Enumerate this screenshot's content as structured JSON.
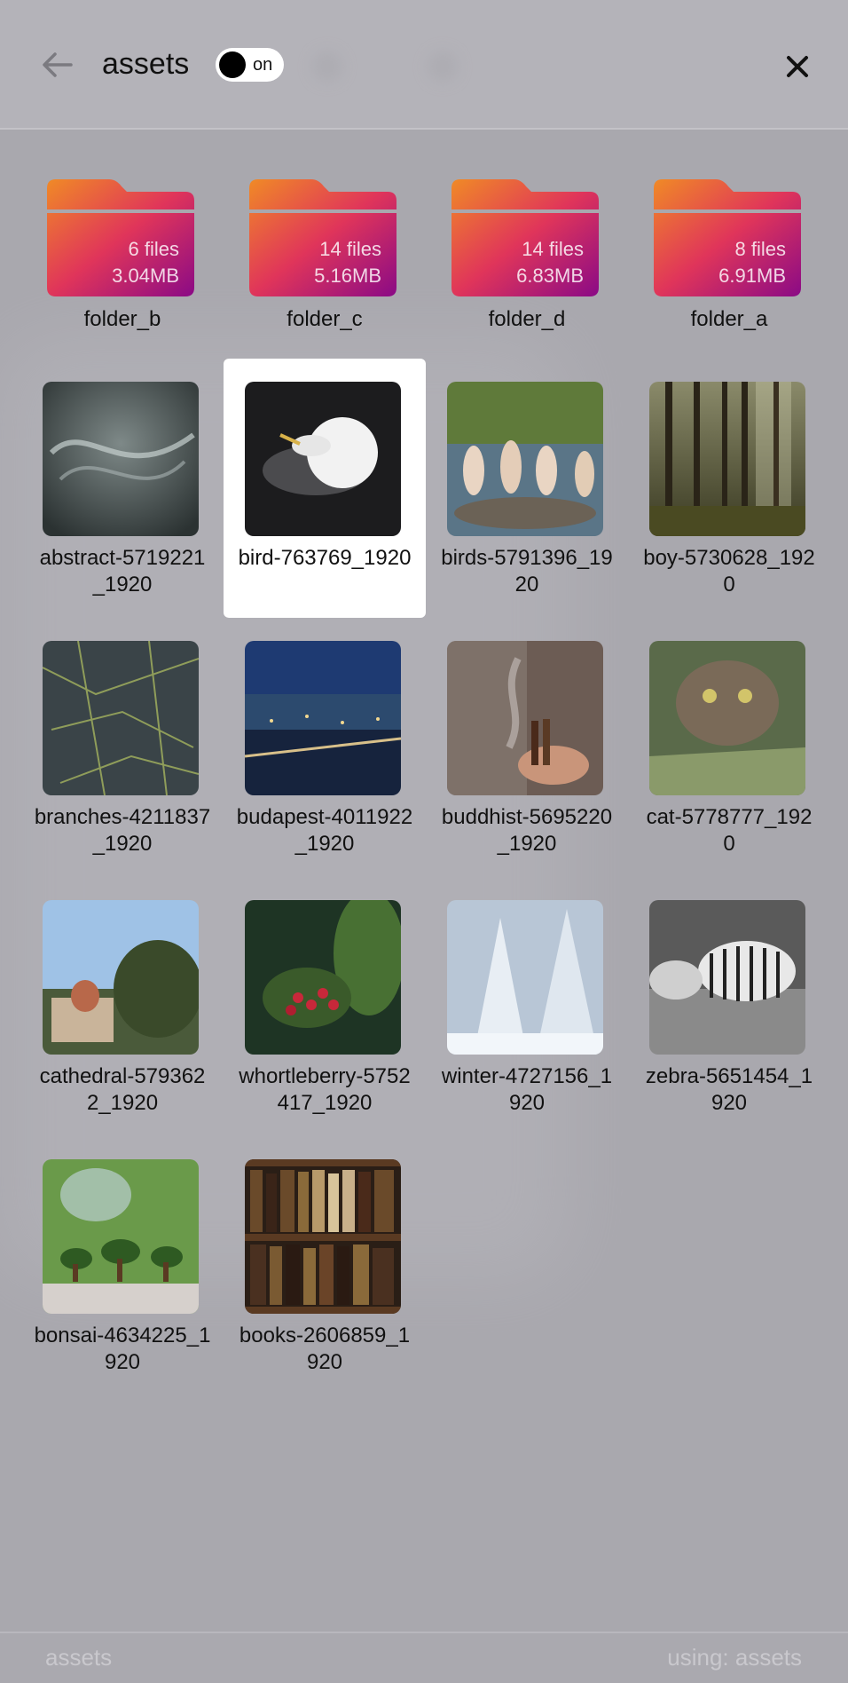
{
  "header": {
    "title": "assets",
    "toggle_label": "on"
  },
  "folders": [
    {
      "name": "folder_b",
      "files": "6 files",
      "size": "3.04MB"
    },
    {
      "name": "folder_c",
      "files": "14 files",
      "size": "5.16MB"
    },
    {
      "name": "folder_d",
      "files": "14 files",
      "size": "6.83MB"
    },
    {
      "name": "folder_a",
      "files": "8 files",
      "size": "6.91MB"
    }
  ],
  "images": [
    {
      "name": "abstract-5719221_1920"
    },
    {
      "name": "bird-763769_1920"
    },
    {
      "name": "birds-5791396_1920"
    },
    {
      "name": "boy-5730628_1920"
    },
    {
      "name": "branches-4211837_1920"
    },
    {
      "name": "budapest-4011922_1920"
    },
    {
      "name": "buddhist-5695220_1920"
    },
    {
      "name": "cat-5778777_1920"
    },
    {
      "name": "cathedral-5793622_1920"
    },
    {
      "name": "whortleberry-5752417_1920"
    },
    {
      "name": "winter-4727156_1920"
    },
    {
      "name": "zebra-5651454_1920"
    },
    {
      "name": "bonsai-4634225_1920"
    },
    {
      "name": "books-2606859_1920"
    }
  ],
  "selected_image": "bird-763769_1920",
  "footer": {
    "left": "assets",
    "right": "using: assets"
  },
  "colors": {
    "background": "#a9a8ae",
    "folder_top": "#f0852a",
    "folder_bottom": "#8a0a8a"
  }
}
